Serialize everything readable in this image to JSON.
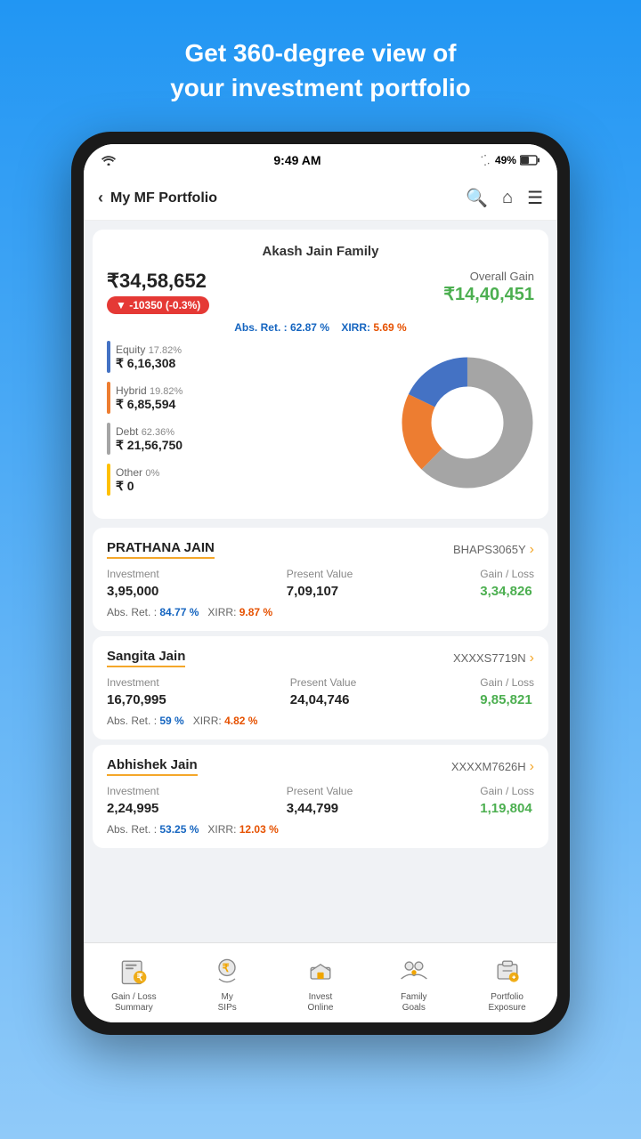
{
  "hero": {
    "line1": "Get 360-degree view of",
    "line2": "your investment portfolio"
  },
  "status_bar": {
    "time": "9:49 AM",
    "battery": "49%"
  },
  "nav": {
    "back_label": "‹",
    "title": "My MF Portfolio"
  },
  "portfolio": {
    "family_name": "Akash Jain Family",
    "total_value": "₹34,58,652",
    "change_badge": "▼ -10350  (-0.3%)",
    "overall_gain_label": "Overall Gain",
    "overall_gain_value": "₹14,40,451",
    "abs_ret_label": "Abs. Ret. :",
    "abs_ret_value": "62.87 %",
    "xirr_label": "XIRR:",
    "xirr_value": "5.69 %",
    "legend": [
      {
        "label": "Equity",
        "pct": "17.82%",
        "amount": "₹ 6,16,308",
        "color": "#4472C4"
      },
      {
        "label": "Hybrid",
        "pct": "19.82%",
        "amount": "₹ 6,85,594",
        "color": "#ED7D31"
      },
      {
        "label": "Debt",
        "pct": "62.36%",
        "amount": "₹ 21,56,750",
        "color": "#A5A5A5"
      },
      {
        "label": "Other",
        "pct": "0%",
        "amount": "₹ 0",
        "color": "#FFC000"
      }
    ],
    "donut": {
      "segments": [
        {
          "label": "Equity",
          "pct": 17.82,
          "color": "#4472C4"
        },
        {
          "label": "Hybrid",
          "pct": 19.82,
          "color": "#ED7D31"
        },
        {
          "label": "Debt",
          "pct": 62.36,
          "color": "#A5A5A5"
        },
        {
          "label": "Other",
          "pct": 0,
          "color": "#FFC000"
        }
      ]
    }
  },
  "members": [
    {
      "name": "PRATHANA JAIN",
      "id": "BHAPS3065Y",
      "investment": "3,95,000",
      "present_value": "7,09,107",
      "gain_loss": "3,34,826",
      "abs_ret": "84.77 %",
      "xirr": "9.87 %"
    },
    {
      "name": "Sangita Jain",
      "id": "XXXXS7719N",
      "investment": "16,70,995",
      "present_value": "24,04,746",
      "gain_loss": "9,85,821",
      "abs_ret": "59 %",
      "xirr": "4.82 %"
    },
    {
      "name": "Abhishek Jain",
      "id": "XXXXM7626H",
      "investment": "2,24,995",
      "present_value": "3,44,799",
      "gain_loss": "1,19,804",
      "abs_ret": "53.25 %",
      "xirr": "12.03 %"
    }
  ],
  "bottom_nav": [
    {
      "id": "gain-loss",
      "label": "Gain / Loss\nSummary",
      "icon": "gain-loss-icon"
    },
    {
      "id": "my-sips",
      "label": "My\nSIPs",
      "icon": "sips-icon"
    },
    {
      "id": "invest",
      "label": "Invest\nOnline",
      "icon": "invest-icon"
    },
    {
      "id": "family",
      "label": "Family\nGoals",
      "icon": "family-icon"
    },
    {
      "id": "portfolio",
      "label": "Portfolio\nExposure",
      "icon": "portfolio-icon"
    }
  ],
  "col_labels": {
    "investment": "Investment",
    "present_value": "Present Value",
    "gain_loss": "Gain / Loss"
  }
}
